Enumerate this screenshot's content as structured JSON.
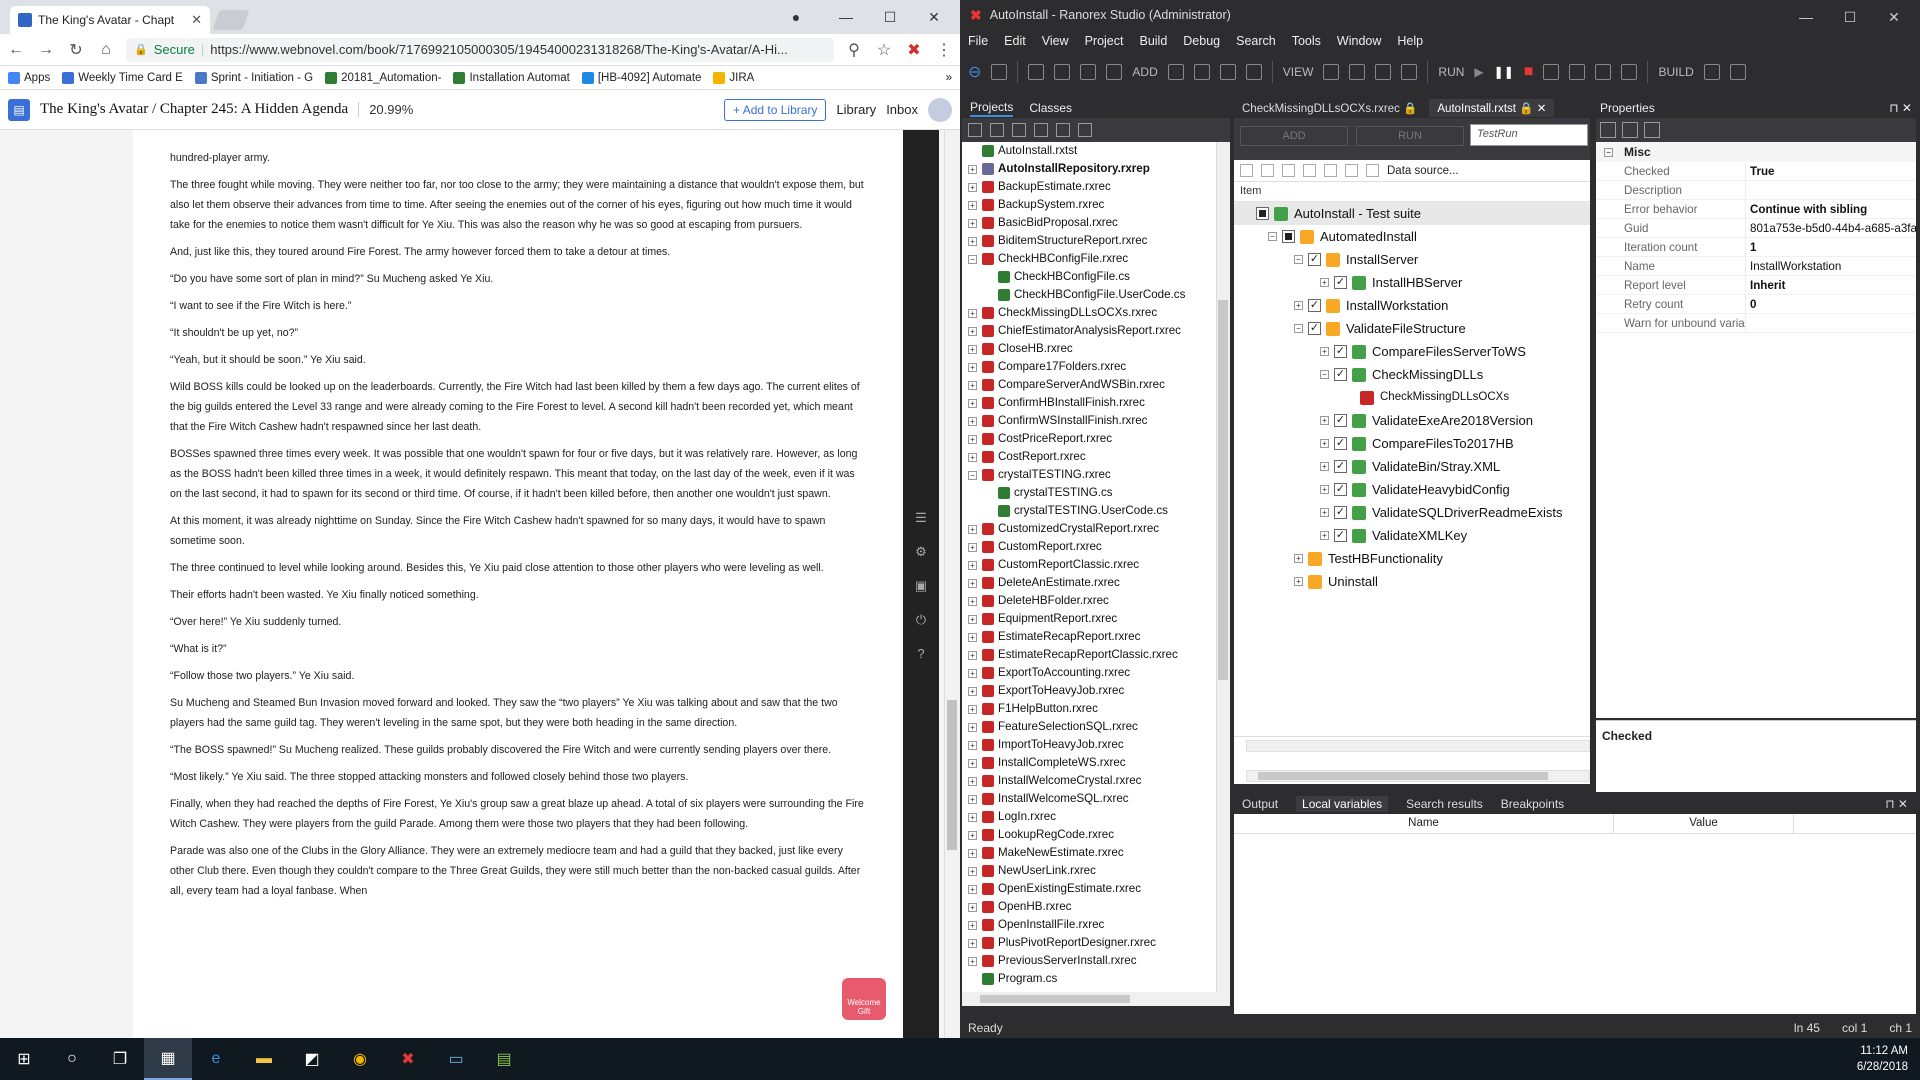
{
  "chrome": {
    "tab_title": "The King's Avatar - Chapt",
    "url_secure": "Secure",
    "url": "https://www.webnovel.com/book/7176992105000305/19454000231318268/The-King's-Avatar/A-Hi...",
    "bookmarks": [
      "Apps",
      "Weekly Time Card E",
      "Sprint - Initiation - G",
      "20181_Automation-",
      "Installation Automat",
      "[HB-4092] Automate",
      "JIRA"
    ],
    "bookmark_colors": [
      "#4285f4",
      "#3a6fd8",
      "#4a78c4",
      "#2e7d32",
      "#2e7d32",
      "#1e88e5",
      "#f4b400"
    ]
  },
  "webnovel": {
    "title": "The King's Avatar / Chapter 245: A Hidden Agenda",
    "progress": "20.99%",
    "add_to_library": "+ Add to Library",
    "library": "Library",
    "inbox": "Inbox",
    "gift": "Welcome Gift",
    "paragraphs": [
      "hundred-player army.",
      "The three fought while moving. They were neither too far, nor too close to the army; they were maintaining a distance that wouldn't expose them, but also let them observe their advances from time to time. After seeing the enemies out of the corner of his eyes, figuring out how much time it would take for the enemies to notice them wasn't difficult for Ye Xiu. This was also the reason why he was so good at escaping from pursuers.",
      "And, just like this, they toured around Fire Forest. The army however forced them to take a detour at times.",
      "“Do you have some sort of plan in mind?” Su Mucheng asked Ye Xiu.",
      "“I want to see if the Fire Witch is here.”",
      "“It shouldn't be up yet, no?”",
      "“Yeah, but it should be soon.” Ye Xiu said.",
      "Wild BOSS kills could be looked up on the leaderboards. Currently, the Fire Witch had last been killed by them a few days ago. The current elites of the big guilds entered the Level 33 range and were already coming to the Fire Forest to level. A second kill hadn't been recorded yet, which meant that the Fire Witch Cashew hadn't respawned since her last death.",
      "BOSSes spawned three times every week. It was possible that one wouldn't spawn for four or five days, but it was relatively rare. However, as long as the BOSS hadn't been killed three times in a week, it would definitely respawn. This meant that today, on the last day of the week, even if it was on the last second, it had to spawn for its second or third time. Of course, if it hadn't been killed before, then another one wouldn't just spawn.",
      "At this moment, it was already nighttime on Sunday. Since the Fire Witch Cashew hadn't spawned for so many days, it would have to spawn sometime soon.",
      "The three continued to level while looking around. Besides this, Ye Xiu paid close attention to those other players who were leveling as well.",
      "Their efforts hadn't been wasted. Ye Xiu finally noticed something.",
      "“Over here!” Ye Xiu suddenly turned.",
      "“What is it?”",
      "“Follow those two players.” Ye Xiu said.",
      "Su Mucheng and Steamed Bun Invasion moved forward and looked. They saw the “two players” Ye Xiu was talking about and saw that the two players had the same guild tag. They weren't leveling in the same spot, but they were both heading in the same direction.",
      "“The BOSS spawned!” Su Mucheng realized. These guilds probably discovered the Fire Witch and were currently sending players over there.",
      "“Most likely.” Ye Xiu said. The three stopped attacking monsters and followed closely behind those two players.",
      "Finally, when they had reached the depths of Fire Forest, Ye Xiu's group saw a great blaze up ahead. A total of six players were surrounding the Fire Witch Cashew. They were players from the guild Parade. Among them were those two players that they had been following.",
      "Parade was also one of the Clubs in the Glory Alliance. They were an extremely mediocre team and had a guild that they backed, just like every other Club there. Even though they couldn't compare to the Three Great Guilds, they were still much better than the non-backed casual guilds. After all, every team had a loyal fanbase. When"
    ]
  },
  "ranorex": {
    "title": "AutoInstall - Ranorex Studio (Administrator)",
    "menu": [
      "File",
      "Edit",
      "View",
      "Project",
      "Build",
      "Debug",
      "Search",
      "Tools",
      "Window",
      "Help"
    ],
    "toolbar": {
      "add": "ADD",
      "view": "VIEW",
      "run": "RUN",
      "build": "BUILD"
    },
    "projects_tabs": [
      "Projects",
      "Classes"
    ],
    "project_items": [
      {
        "label": "AutoInstall.rxtst",
        "indent": 0,
        "exp": "",
        "bold": false,
        "color": "#2e7d32"
      },
      {
        "label": "AutoInstallRepository.rxrep",
        "indent": 0,
        "exp": "+",
        "bold": true,
        "color": "#6a6a9a"
      },
      {
        "label": "BackupEstimate.rxrec",
        "indent": 0,
        "exp": "+",
        "bold": false,
        "color": "#c62828"
      },
      {
        "label": "BackupSystem.rxrec",
        "indent": 0,
        "exp": "+",
        "bold": false,
        "color": "#c62828"
      },
      {
        "label": "BasicBidProposal.rxrec",
        "indent": 0,
        "exp": "+",
        "bold": false,
        "color": "#c62828"
      },
      {
        "label": "BiditemStructureReport.rxrec",
        "indent": 0,
        "exp": "+",
        "bold": false,
        "color": "#c62828"
      },
      {
        "label": "CheckHBConfigFile.rxrec",
        "indent": 0,
        "exp": "-",
        "bold": false,
        "color": "#c62828"
      },
      {
        "label": "CheckHBConfigFile.cs",
        "indent": 1,
        "exp": "",
        "bold": false,
        "color": "#2e7d32"
      },
      {
        "label": "CheckHBConfigFile.UserCode.cs",
        "indent": 1,
        "exp": "",
        "bold": false,
        "color": "#2e7d32"
      },
      {
        "label": "CheckMissingDLLsOCXs.rxrec",
        "indent": 0,
        "exp": "+",
        "bold": false,
        "color": "#c62828"
      },
      {
        "label": "ChiefEstimatorAnalysisReport.rxrec",
        "indent": 0,
        "exp": "+",
        "bold": false,
        "color": "#c62828"
      },
      {
        "label": "CloseHB.rxrec",
        "indent": 0,
        "exp": "+",
        "bold": false,
        "color": "#c62828"
      },
      {
        "label": "Compare17Folders.rxrec",
        "indent": 0,
        "exp": "+",
        "bold": false,
        "color": "#c62828"
      },
      {
        "label": "CompareServerAndWSBin.rxrec",
        "indent": 0,
        "exp": "+",
        "bold": false,
        "color": "#c62828"
      },
      {
        "label": "ConfirmHBInstallFinish.rxrec",
        "indent": 0,
        "exp": "+",
        "bold": false,
        "color": "#c62828"
      },
      {
        "label": "ConfirmWSInstallFinish.rxrec",
        "indent": 0,
        "exp": "+",
        "bold": false,
        "color": "#c62828"
      },
      {
        "label": "CostPriceReport.rxrec",
        "indent": 0,
        "exp": "+",
        "bold": false,
        "color": "#c62828"
      },
      {
        "label": "CostReport.rxrec",
        "indent": 0,
        "exp": "+",
        "bold": false,
        "color": "#c62828"
      },
      {
        "label": "crystalTESTING.rxrec",
        "indent": 0,
        "exp": "-",
        "bold": false,
        "color": "#c62828"
      },
      {
        "label": "crystalTESTING.cs",
        "indent": 1,
        "exp": "",
        "bold": false,
        "color": "#2e7d32"
      },
      {
        "label": "crystalTESTING.UserCode.cs",
        "indent": 1,
        "exp": "",
        "bold": false,
        "color": "#2e7d32"
      },
      {
        "label": "CustomizedCrystalReport.rxrec",
        "indent": 0,
        "exp": "+",
        "bold": false,
        "color": "#c62828"
      },
      {
        "label": "CustomReport.rxrec",
        "indent": 0,
        "exp": "+",
        "bold": false,
        "color": "#c62828"
      },
      {
        "label": "CustomReportClassic.rxrec",
        "indent": 0,
        "exp": "+",
        "bold": false,
        "color": "#c62828"
      },
      {
        "label": "DeleteAnEstimate.rxrec",
        "indent": 0,
        "exp": "+",
        "bold": false,
        "color": "#c62828"
      },
      {
        "label": "DeleteHBFolder.rxrec",
        "indent": 0,
        "exp": "+",
        "bold": false,
        "color": "#c62828"
      },
      {
        "label": "EquipmentReport.rxrec",
        "indent": 0,
        "exp": "+",
        "bold": false,
        "color": "#c62828"
      },
      {
        "label": "EstimateRecapReport.rxrec",
        "indent": 0,
        "exp": "+",
        "bold": false,
        "color": "#c62828"
      },
      {
        "label": "EstimateRecapReportClassic.rxrec",
        "indent": 0,
        "exp": "+",
        "bold": false,
        "color": "#c62828"
      },
      {
        "label": "ExportToAccounting.rxrec",
        "indent": 0,
        "exp": "+",
        "bold": false,
        "color": "#c62828"
      },
      {
        "label": "ExportToHeavyJob.rxrec",
        "indent": 0,
        "exp": "+",
        "bold": false,
        "color": "#c62828"
      },
      {
        "label": "F1HelpButton.rxrec",
        "indent": 0,
        "exp": "+",
        "bold": false,
        "color": "#c62828"
      },
      {
        "label": "FeatureSelectionSQL.rxrec",
        "indent": 0,
        "exp": "+",
        "bold": false,
        "color": "#c62828"
      },
      {
        "label": "ImportToHeavyJob.rxrec",
        "indent": 0,
        "exp": "+",
        "bold": false,
        "color": "#c62828"
      },
      {
        "label": "InstallCompleteWS.rxrec",
        "indent": 0,
        "exp": "+",
        "bold": false,
        "color": "#c62828"
      },
      {
        "label": "InstallWelcomeCrystal.rxrec",
        "indent": 0,
        "exp": "+",
        "bold": false,
        "color": "#c62828"
      },
      {
        "label": "InstallWelcomeSQL.rxrec",
        "indent": 0,
        "exp": "+",
        "bold": false,
        "color": "#c62828"
      },
      {
        "label": "LogIn.rxrec",
        "indent": 0,
        "exp": "+",
        "bold": false,
        "color": "#c62828"
      },
      {
        "label": "LookupRegCode.rxrec",
        "indent": 0,
        "exp": "+",
        "bold": false,
        "color": "#c62828"
      },
      {
        "label": "MakeNewEstimate.rxrec",
        "indent": 0,
        "exp": "+",
        "bold": false,
        "color": "#c62828"
      },
      {
        "label": "NewUserLink.rxrec",
        "indent": 0,
        "exp": "+",
        "bold": false,
        "color": "#c62828"
      },
      {
        "label": "OpenExistingEstimate.rxrec",
        "indent": 0,
        "exp": "+",
        "bold": false,
        "color": "#c62828"
      },
      {
        "label": "OpenHB.rxrec",
        "indent": 0,
        "exp": "+",
        "bold": false,
        "color": "#c62828"
      },
      {
        "label": "OpenInstallFile.rxrec",
        "indent": 0,
        "exp": "+",
        "bold": false,
        "color": "#c62828"
      },
      {
        "label": "PlusPivotReportDesigner.rxrec",
        "indent": 0,
        "exp": "+",
        "bold": false,
        "color": "#c62828"
      },
      {
        "label": "PreviousServerInstall.rxrec",
        "indent": 0,
        "exp": "+",
        "bold": false,
        "color": "#c62828"
      },
      {
        "label": "Program.cs",
        "indent": 0,
        "exp": "",
        "bold": false,
        "color": "#2e7d32"
      }
    ],
    "editor_tabs": [
      "CheckMissingDLLsOCXs.rxrec",
      "AutoInstall.rxtst"
    ],
    "editor_add": "ADD",
    "editor_run": "RUN",
    "testrun": "TestRun",
    "data_source": "Data source...",
    "item_col": "Item",
    "suite_items": [
      {
        "label": "AutoInstall - Test suite",
        "indent": 0,
        "exp": "",
        "cb": "sq",
        "kind": "suite",
        "bold": false,
        "hl": true
      },
      {
        "label": "AutomatedInstall",
        "indent": 1,
        "exp": "-",
        "cb": "sq",
        "kind": "folder",
        "bold": false,
        "hl": false
      },
      {
        "label": "InstallServer",
        "indent": 2,
        "exp": "-",
        "cb": "✓",
        "kind": "folder",
        "bold": false,
        "hl": false
      },
      {
        "label": "InstallHBServer",
        "indent": 3,
        "exp": "+",
        "cb": "✓",
        "kind": "case",
        "bold": false,
        "hl": false
      },
      {
        "label": "InstallWorkstation",
        "indent": 2,
        "exp": "+",
        "cb": "✓",
        "kind": "folder",
        "bold": false,
        "hl": false
      },
      {
        "label": "ValidateFileStructure",
        "indent": 2,
        "exp": "-",
        "cb": "✓",
        "kind": "folder",
        "bold": false,
        "hl": false
      },
      {
        "label": "CompareFilesServerToWS",
        "indent": 3,
        "exp": "+",
        "cb": "✓",
        "kind": "case",
        "bold": false,
        "hl": false
      },
      {
        "label": "CheckMissingDLLs",
        "indent": 3,
        "exp": "-",
        "cb": "✓",
        "kind": "case",
        "bold": false,
        "hl": false
      },
      {
        "label": "CheckMissingDLLsOCXs",
        "indent": 4,
        "exp": "",
        "cb": "",
        "kind": "rec",
        "bold": false,
        "hl": false
      },
      {
        "label": "ValidateExeAre2018Version",
        "indent": 3,
        "exp": "+",
        "cb": "✓",
        "kind": "case",
        "bold": false,
        "hl": false
      },
      {
        "label": "CompareFilesTo2017HB",
        "indent": 3,
        "exp": "+",
        "cb": "✓",
        "kind": "case",
        "bold": false,
        "hl": false
      },
      {
        "label": "ValidateBin/Stray.XML",
        "indent": 3,
        "exp": "+",
        "cb": "✓",
        "kind": "case",
        "bold": false,
        "hl": false
      },
      {
        "label": "ValidateHeavybidConfig",
        "indent": 3,
        "exp": "+",
        "cb": "✓",
        "kind": "case",
        "bold": false,
        "hl": false
      },
      {
        "label": "ValidateSQLDriverReadmeExists",
        "indent": 3,
        "exp": "+",
        "cb": "✓",
        "kind": "case",
        "bold": false,
        "hl": false
      },
      {
        "label": "ValidateXMLKey",
        "indent": 3,
        "exp": "+",
        "cb": "✓",
        "kind": "case",
        "bold": false,
        "hl": false
      },
      {
        "label": "TestHBFunctionality",
        "indent": 2,
        "exp": "+",
        "cb": "",
        "kind": "folder",
        "bold": false,
        "hl": false
      },
      {
        "label": "Uninstall",
        "indent": 2,
        "exp": "+",
        "cb": "",
        "kind": "folder",
        "bold": false,
        "hl": false
      }
    ],
    "properties": {
      "title": "Properties",
      "category": "Misc",
      "rows": [
        {
          "k": "Checked",
          "v": "True",
          "b": true
        },
        {
          "k": "Description",
          "v": "",
          "b": false
        },
        {
          "k": "Error behavior",
          "v": "Continue with sibling",
          "b": true
        },
        {
          "k": "Guid",
          "v": "801a753e-b5d0-44b4-a685-a3fa",
          "b": false
        },
        {
          "k": "Iteration count",
          "v": "1",
          "b": true
        },
        {
          "k": "Name",
          "v": "InstallWorkstation",
          "b": false
        },
        {
          "k": "Report level",
          "v": "Inherit",
          "b": true
        },
        {
          "k": "Retry count",
          "v": "0",
          "b": true
        },
        {
          "k": "Warn for unbound varia",
          "v": "",
          "b": false
        }
      ],
      "description_title": "Checked"
    },
    "bottom_tabs": [
      "Output",
      "Local variables",
      "Search results",
      "Breakpoints"
    ],
    "bottom_cols": [
      "Name",
      "Value"
    ],
    "status": {
      "left": "Ready",
      "ln": "ln 45",
      "col": "col 1",
      "ch": "ch 1"
    }
  },
  "taskbar": {
    "time": "11:12 AM",
    "date": "6/28/2018"
  }
}
